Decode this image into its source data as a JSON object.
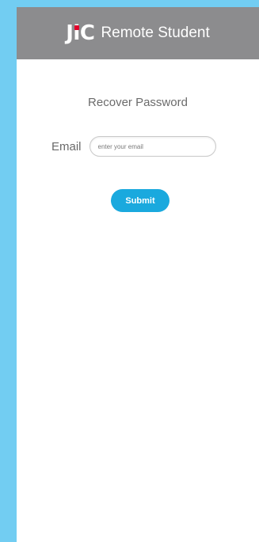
{
  "header": {
    "logo_text": "JiC",
    "logo_prefix": "J",
    "logo_i": "i",
    "logo_suffix": "C",
    "app_name": "Remote Student"
  },
  "form": {
    "title": "Recover Password",
    "email_label": "Email",
    "email_value": "",
    "email_placeholder": "enter your email",
    "submit_label": "Submit"
  },
  "colors": {
    "background": "#72cdf2",
    "header": "#8c8c8e",
    "logo_dot": "#e2002a",
    "submit_button": "#1aa9de"
  }
}
